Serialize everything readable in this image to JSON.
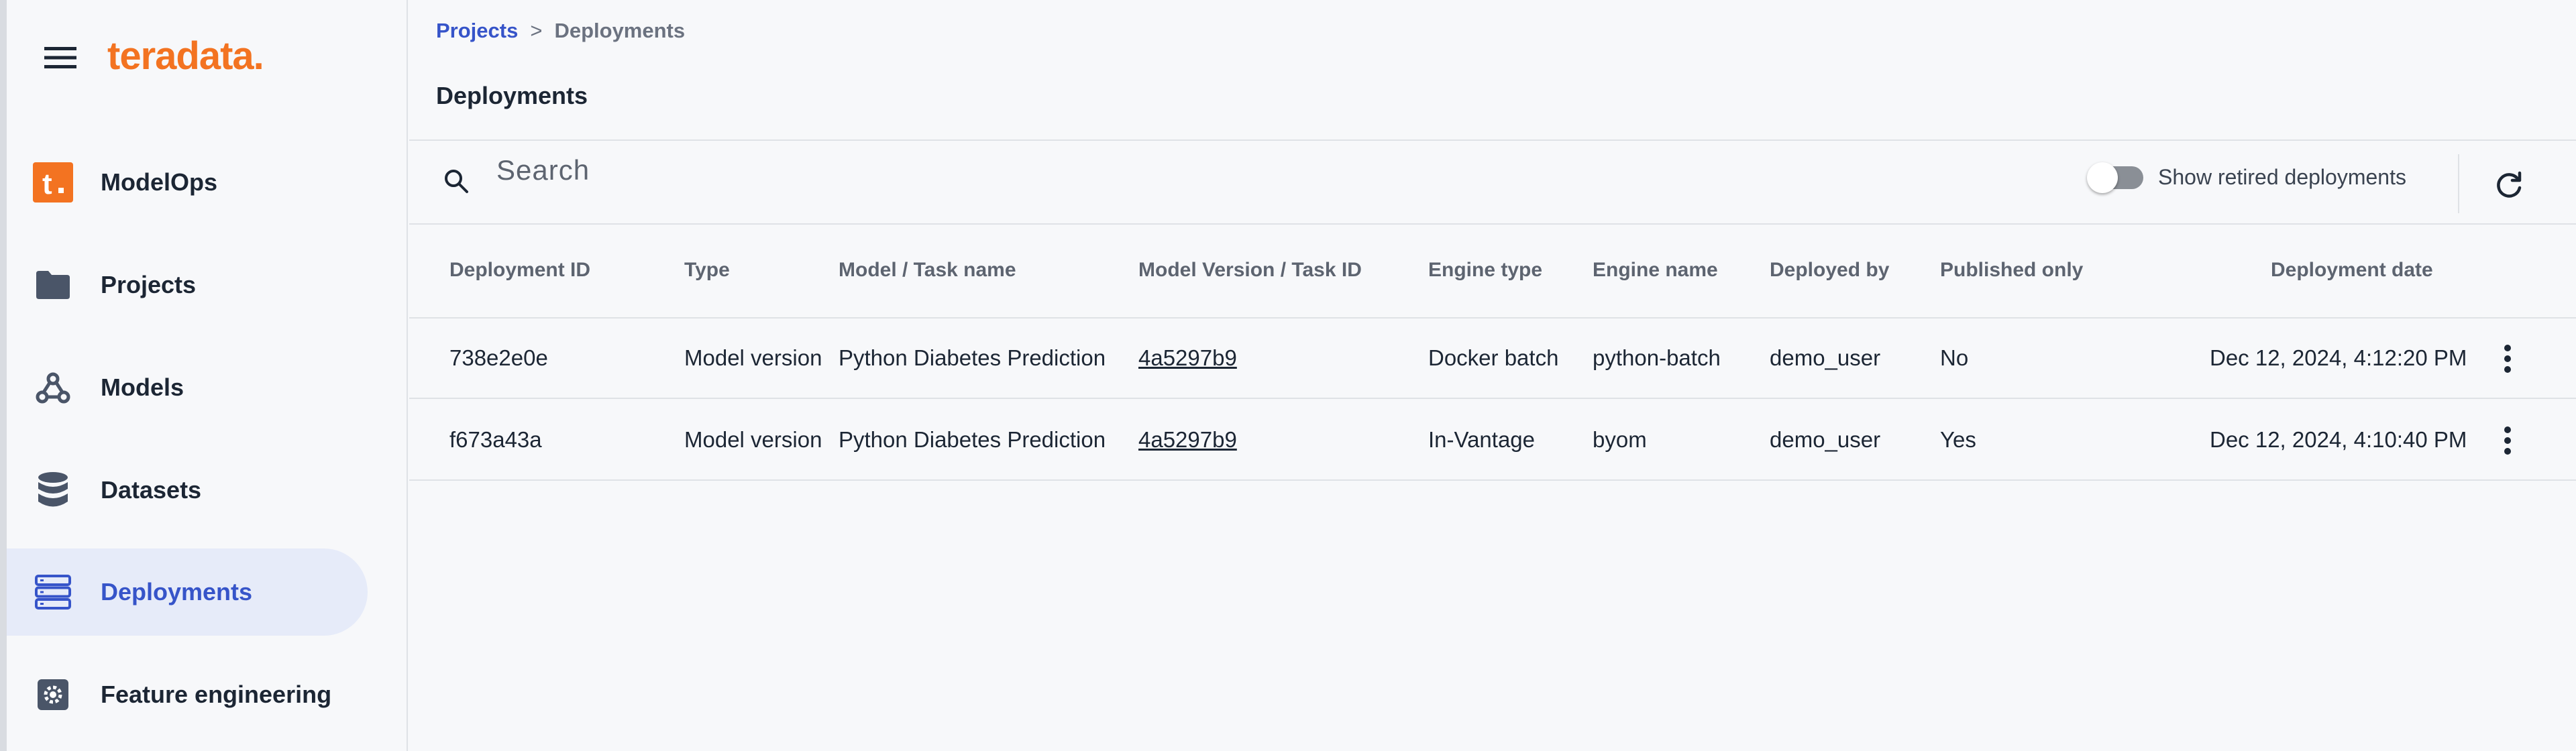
{
  "app": {
    "logo_text": "teradata.",
    "brand_color": "#f37321",
    "accent_color": "#3654c9"
  },
  "sidebar": {
    "items": [
      {
        "label": "ModelOps",
        "icon": "teradata-t-icon"
      },
      {
        "label": "Projects",
        "icon": "folder-icon"
      },
      {
        "label": "Models",
        "icon": "webhook-icon"
      },
      {
        "label": "Datasets",
        "icon": "database-icon"
      },
      {
        "label": "Deployments",
        "icon": "dns-icon",
        "active": true
      },
      {
        "label": "Feature engineering",
        "icon": "settings-icon"
      }
    ]
  },
  "breadcrumb": {
    "parent": "Projects",
    "separator": ">",
    "current": "Deployments"
  },
  "page": {
    "title": "Deployments"
  },
  "toolbar": {
    "search_placeholder": "Search",
    "search_value": "",
    "toggle_label": "Show retired deployments",
    "toggle_on": false
  },
  "table": {
    "columns": [
      "Deployment ID",
      "Type",
      "Model / Task name",
      "Model Version / Task ID",
      "Engine type",
      "Engine name",
      "Deployed by",
      "Published only",
      "Deployment date"
    ],
    "rows": [
      [
        "738e2e0e",
        "Model version",
        "Python Diabetes Prediction",
        "4a5297b9",
        "Docker batch",
        "python-batch",
        "demo_user",
        "No",
        "Dec 12, 2024, 4:12:20 PM"
      ],
      [
        "f673a43a",
        "Model version",
        "Python Diabetes Prediction",
        "4a5297b9",
        "In-Vantage",
        "byom",
        "demo_user",
        "Yes",
        "Dec 12, 2024, 4:10:40 PM"
      ]
    ]
  }
}
